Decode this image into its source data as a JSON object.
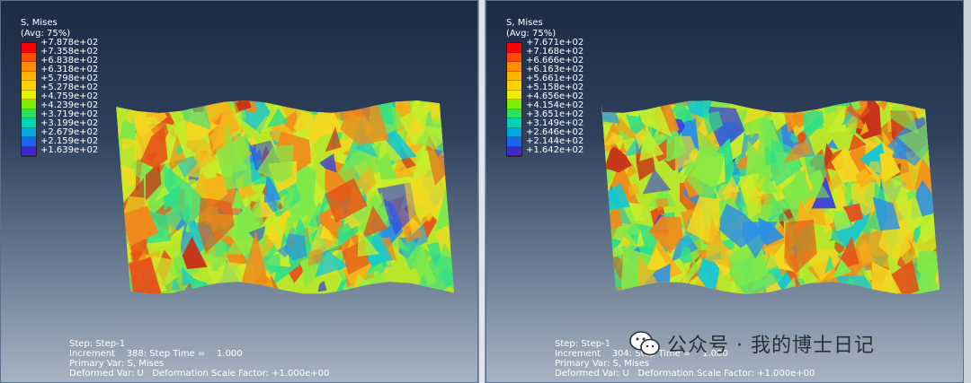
{
  "viewports": [
    {
      "legend": {
        "title_line1": "S, Mises",
        "title_line2": "(Avg: 75%)",
        "values": [
          "+7.878e+02",
          "+7.358e+02",
          "+6.838e+02",
          "+6.318e+02",
          "+5.798e+02",
          "+5.278e+02",
          "+4.759e+02",
          "+4.239e+02",
          "+3.719e+02",
          "+3.199e+02",
          "+2.679e+02",
          "+2.159e+02",
          "+1.639e+02"
        ]
      },
      "info": {
        "step": "Step: Step-1",
        "increment": "Increment    388: Step Time =    1.000",
        "primary_var": "Primary Var: S, Mises",
        "deformed_var": "Deformed Var: U   Deformation Scale Factor: +1.000e+00"
      }
    },
    {
      "legend": {
        "title_line1": "S, Mises",
        "title_line2": "(Avg: 75%)",
        "values": [
          "+7.671e+02",
          "+7.168e+02",
          "+6.666e+02",
          "+6.163e+02",
          "+5.661e+02",
          "+5.158e+02",
          "+4.656e+02",
          "+4.154e+02",
          "+3.651e+02",
          "+3.149e+02",
          "+2.646e+02",
          "+2.144e+02",
          "+1.642e+02"
        ]
      },
      "info": {
        "step": "Step: Step-1",
        "increment": "Increment    304: Step Time =    1.000",
        "primary_var": "Primary Var: S, Mises",
        "deformed_var": "Deformed Var: U   Deformation Scale Factor: +1.000e+00"
      }
    }
  ],
  "legend_colors": [
    "#ff0000",
    "#ff4a00",
    "#ff8c00",
    "#ffb400",
    "#ffd200",
    "#e6f000",
    "#7cf000",
    "#2de05a",
    "#00d4b4",
    "#00a8e6",
    "#1e64f0",
    "#3a28c8"
  ],
  "watermark": {
    "text": "公众号 · 我的博士日记",
    "icon": "wechat-icon"
  }
}
